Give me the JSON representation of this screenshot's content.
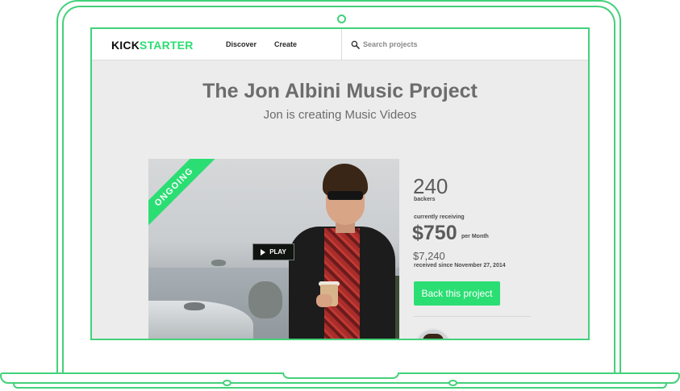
{
  "colors": {
    "brand_green": "#2bde73",
    "outline_green": "#43d17a",
    "text_gray": "#6c6c6c"
  },
  "header": {
    "logo_text_1": "KICK",
    "logo_text_2": "STARTER",
    "nav": {
      "discover": "Discover",
      "create": "Create"
    },
    "search": {
      "placeholder": "Search projects",
      "icon": "search-icon"
    }
  },
  "project": {
    "title": "The Jon Albini Music Project",
    "subtitle": "Jon is creating Music Videos"
  },
  "video": {
    "ribbon": "ONGOING",
    "play_label": "PLAY",
    "play_icon": "play-icon"
  },
  "stats": {
    "backers_count": "240",
    "backers_label": "backers",
    "currently_receiving_label": "currently receiving",
    "amount": "$750",
    "per_label": "per Month",
    "received_total": "$7,240",
    "received_since": "received since November 27, 2014",
    "back_button": "Back this project"
  }
}
